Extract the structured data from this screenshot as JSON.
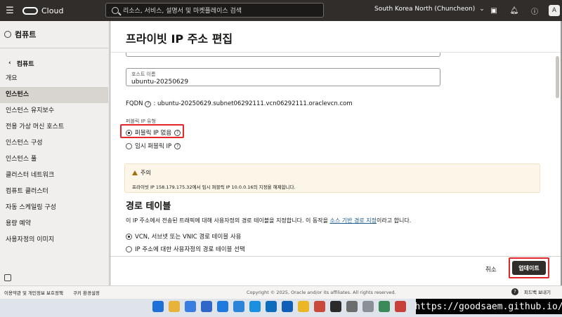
{
  "topbar": {
    "logo_text": "Cloud",
    "search_placeholder": "리소스, 서비스, 설명서 및 마켓플레이스 검색",
    "region": "South Korea North (Chuncheon)",
    "avatar_letter": "A"
  },
  "sidebar": {
    "title": "컴퓨트",
    "back_label": "컴퓨트",
    "items": [
      {
        "label": "개요"
      },
      {
        "label": "인스턴스"
      },
      {
        "label": "인스턴스 유지보수"
      },
      {
        "label": "전용 가상 머신 호스트"
      },
      {
        "label": "인스턴스 구성"
      },
      {
        "label": "인스턴스 풀"
      },
      {
        "label": "클러스터 네트워크"
      },
      {
        "label": "컴퓨트 클러스터"
      },
      {
        "label": "자동 스케일링 구성"
      },
      {
        "label": "용량 예약"
      },
      {
        "label": "사용자정의 이미지"
      }
    ]
  },
  "panel": {
    "title": "프라이빗 IP 주소 편집",
    "hostname_label": "호스트 이름",
    "hostname_value": "ubuntu-20250629",
    "fqdn_label": "FQDN",
    "fqdn_value": ": ubuntu-20250629.subnet06292111.vcn06292111.oraclevcn.com",
    "public_ip_type_label": "퍼블릭 IP 유형",
    "options": {
      "no_public_ip": "퍼블릭 IP 없음",
      "ephemeral_public_ip": "임시 퍼블릭 IP"
    },
    "notice_title": "주의",
    "notice_body": "프라이빗 IP 158.179.175.32에서 임시 퍼블릭 IP 10.0.0.16의 지정을 해제합니다.",
    "route_table_title": "경로 테이블",
    "route_desc_pre": "이 IP 주소에서 전송된 트래픽에 대해 사용자정의 경로 테이블을 지정합니다. 이 동작을 ",
    "route_desc_link": "소스 기반 경로 지정",
    "route_desc_post": "이라고 합니다.",
    "route_options": {
      "use_vnic": "VCN, 서브넷 또는 VNIC 경로 테이블 사용",
      "select_custom": "IP 주소에 대한 사용자정의 경로 테이블 선택"
    },
    "cancel_label": "취소",
    "update_label": "업데이트"
  },
  "footer": {
    "terms": "이용약관 및 개인정보 보호정책",
    "cookies": "쿠키 환경설정",
    "copyright": "Copyright © 2025, Oracle and/or its affiliates. All rights reserved.",
    "feedback": "피드백 보내기"
  },
  "taskbar": {
    "icons": [
      "windows-start",
      "file-explorer",
      "browser-chrome",
      "app-blue-1",
      "app-blue-2",
      "app-blue-3",
      "app-skype",
      "app-mail",
      "app-outlook",
      "app-yellow",
      "app-red",
      "app-terminal",
      "app-settings",
      "app-gray",
      "app-green",
      "app-red-2"
    ],
    "icon_colors": [
      "#1e6fd9",
      "#e8b33a",
      "#3b7ce0",
      "#2f66c7",
      "#1f7ae0",
      "#2b84d8",
      "#1b8fe0",
      "#0f6cbd",
      "#0f5fb8",
      "#e9b728",
      "#c94a3a",
      "#2b2b2b",
      "#6d6d6d",
      "#8a8f98",
      "#3a8a5a",
      "#c7413a"
    ]
  },
  "watermark": "https://goodsaem.github.io/"
}
